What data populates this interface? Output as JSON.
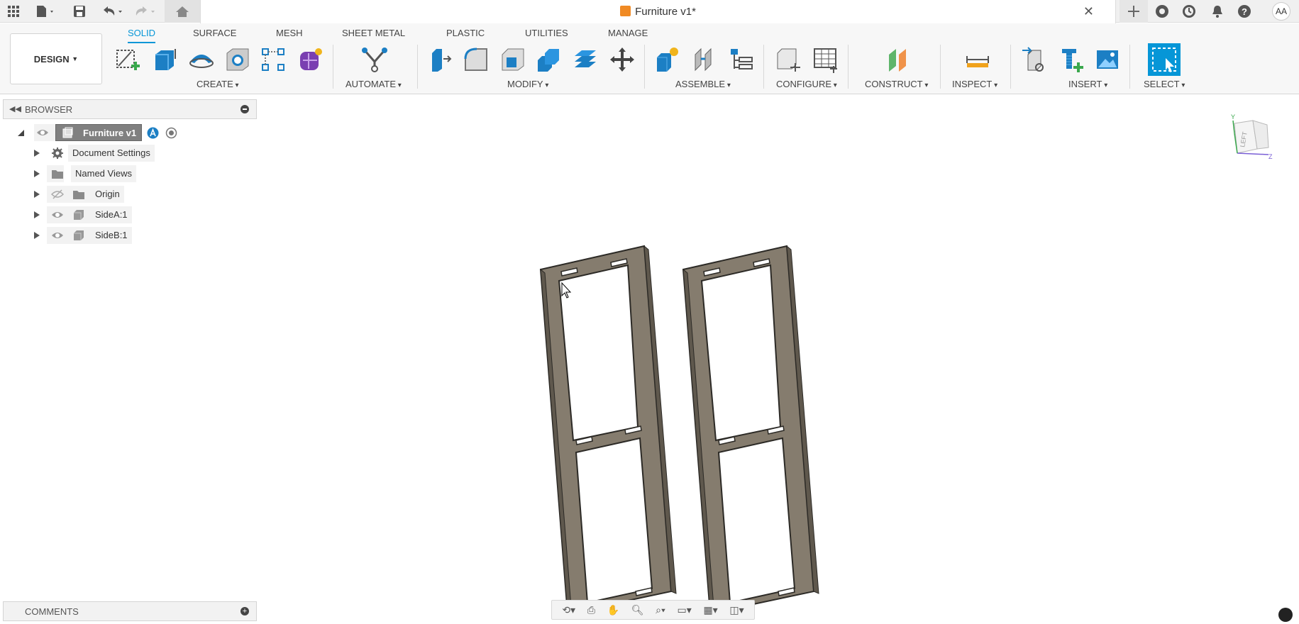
{
  "topbar": {
    "doc_title": "Furniture v1*",
    "close_glyph": "✕",
    "avatar_initials": "AA",
    "icons": [
      "apps-grid-icon",
      "file-icon",
      "save-icon",
      "undo-icon",
      "redo-icon",
      "home-icon",
      "new-tab-plus-icon",
      "extensions-icon",
      "job-status-icon",
      "notifications-icon",
      "help-icon"
    ]
  },
  "ribbon": {
    "workspace": "DESIGN",
    "tabs": [
      {
        "label": "SOLID",
        "active": true
      },
      {
        "label": "SURFACE"
      },
      {
        "label": "MESH"
      },
      {
        "label": "SHEET METAL"
      },
      {
        "label": "PLASTIC"
      },
      {
        "label": "UTILITIES"
      },
      {
        "label": "MANAGE"
      }
    ],
    "groups": {
      "create": "CREATE",
      "automate": "AUTOMATE",
      "modify": "MODIFY",
      "assemble": "ASSEMBLE",
      "configure": "CONFIGURE",
      "construct": "CONSTRUCT",
      "inspect": "INSPECT",
      "insert": "INSERT",
      "select": "SELECT"
    }
  },
  "browser": {
    "title": "BROWSER",
    "root": "Furniture v1",
    "items": [
      {
        "label": "Document Settings"
      },
      {
        "label": "Named Views"
      },
      {
        "label": "Origin"
      },
      {
        "label": "SideA:1"
      },
      {
        "label": "SideB:1"
      }
    ]
  },
  "comments": {
    "title": "COMMENTS"
  },
  "viewcube": {
    "face": "LEFT",
    "axis_y": "Y",
    "axis_z": "Z"
  },
  "colors": {
    "accent": "#0696d7",
    "part": "#857c6e"
  }
}
